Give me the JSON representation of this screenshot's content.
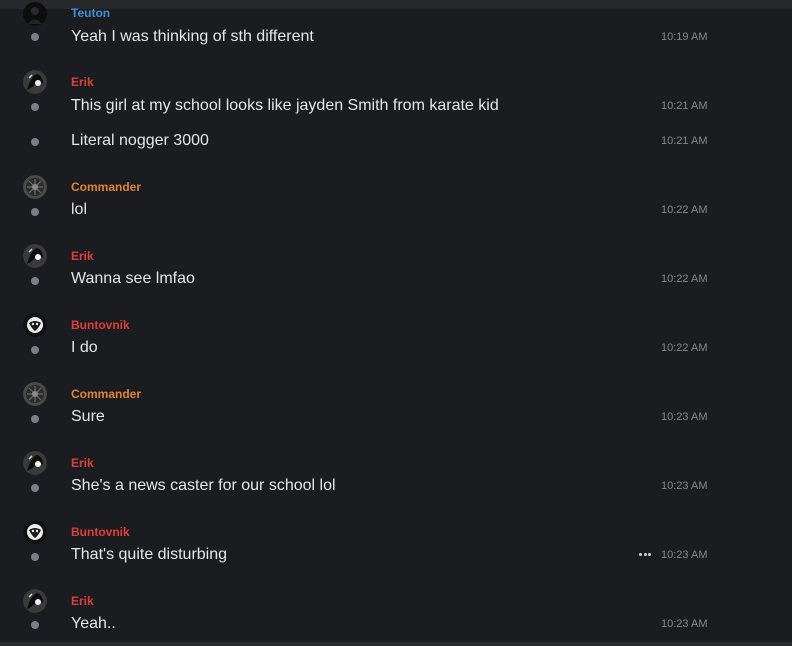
{
  "colors": {
    "background": "#1b1c1f",
    "text": "#e6e6e8",
    "timestamp": "#86878c",
    "author_teuton": "#3f8fd8",
    "author_erik": "#d9403a",
    "author_commander": "#e0823a",
    "author_buntovnik": "#d9403a"
  },
  "messages": [
    {
      "author": "Teuton",
      "text": "Yeah I was thinking of sth different",
      "time": "10:19 AM"
    },
    {
      "author": "Erik",
      "text": "This girl at my school looks like jayden Smith from karate kid",
      "time": "10:21 AM"
    },
    {
      "author": "",
      "text": "Literal nogger 3000",
      "time": "10:21 AM"
    },
    {
      "author": "Commander",
      "text": "lol",
      "time": "10:22 AM"
    },
    {
      "author": "Erik",
      "text": "Wanna see lmfao",
      "time": "10:22 AM"
    },
    {
      "author": "Buntovnik",
      "text": "I do",
      "time": "10:22 AM"
    },
    {
      "author": "Commander",
      "text": "Sure",
      "time": "10:23 AM"
    },
    {
      "author": "Erik",
      "text": "She's a news caster for our school lol",
      "time": "10:23 AM"
    },
    {
      "author": "Buntovnik",
      "text": "That's quite disturbing",
      "time": "10:23 AM"
    },
    {
      "author": "Erik",
      "text": "Yeah..",
      "time": "10:23 AM"
    }
  ],
  "icons": {
    "more": "more-options-icon",
    "presence": "presence-dot"
  }
}
